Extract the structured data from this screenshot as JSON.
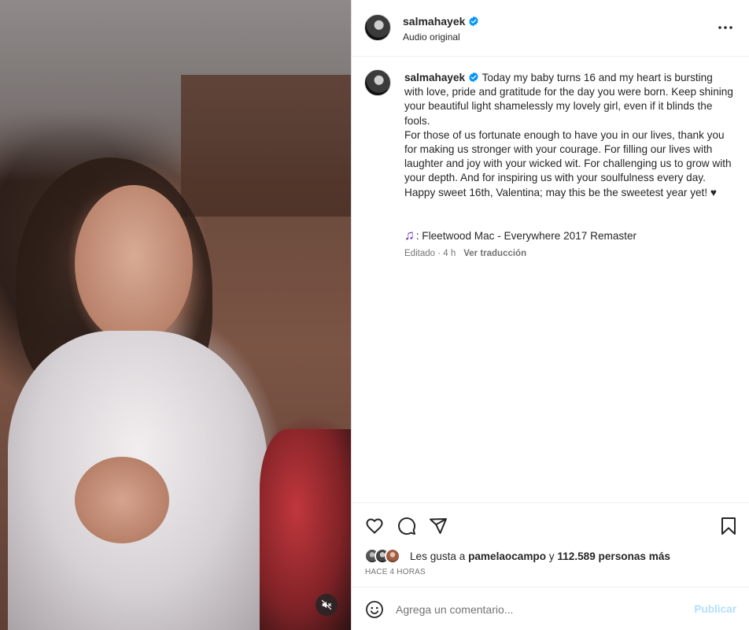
{
  "post": {
    "username": "salmahayek",
    "audio_label": "Audio original",
    "more_icon": "more-horizontal-icon"
  },
  "caption": {
    "username": "salmahayek",
    "text": "Today my baby turns 16 and my heart is bursting with love, pride and gratitude for the day you were born. Keep shining your beautiful light shamelessly my lovely girl, even if it blinds the fools.\nFor those of us fortunate enough to have you in our lives, thank you for making us stronger with your courage. For filling our lives with laughter and joy with your wicked wit. For challenging us to grow with your depth. And for inspiring us with your soulfulness every day. Happy sweet 16th, Valentina; may this be the sweetest year yet! ♥",
    "song": ": Fleetwood Mac - Everywhere 2017 Remaster",
    "edited": "Editado · 4 h",
    "translate": "Ver traducción"
  },
  "likes": {
    "prefix": "Les gusta a ",
    "user": "pamelaocampo",
    "joiner": " y ",
    "count": "112.589 personas más",
    "time": "HACE 4 HORAS"
  },
  "comment": {
    "placeholder": "Agrega un comentario...",
    "publish": "Publicar"
  },
  "colors": {
    "verified": "#0095f6",
    "publish_disabled": "#b2dffc",
    "secondary_text": "#737373"
  }
}
